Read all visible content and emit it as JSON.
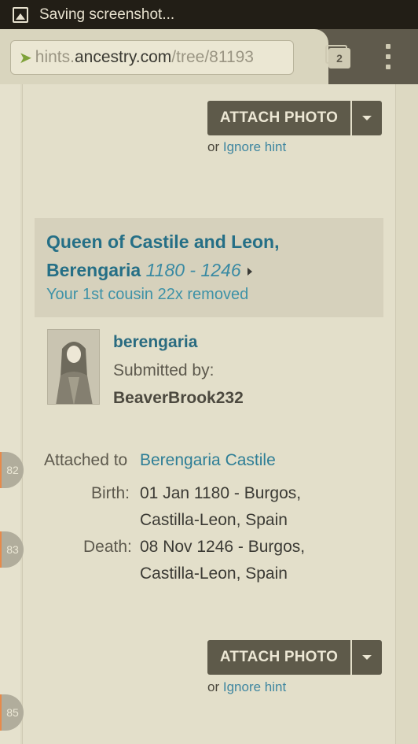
{
  "statusbar": {
    "text": "Saving screenshot..."
  },
  "browser": {
    "url_prefix": "hints.",
    "url_domain": "ancestry.com",
    "url_path": "/tree/81193",
    "tab_count": "2"
  },
  "actions": {
    "attach_label": "ATTACH PHOTO",
    "or_text": "or",
    "ignore_label": "Ignore hint"
  },
  "hint": {
    "name_line1": "Queen of Castile and Leon,",
    "name_line2": "Berengaria",
    "years": "1180 - 1246",
    "relationship": "Your 1st cousin 22x removed"
  },
  "record": {
    "title": "berengaria",
    "submitted_label": "Submitted by:",
    "submitter": "BeaverBrook232",
    "attached_label": "Attached to",
    "attached_to": "Berengaria Castile",
    "birth_label": "Birth:",
    "birth_line1": "01 Jan 1180 - Burgos,",
    "birth_line2": "Castilla-Leon, Spain",
    "death_label": "Death:",
    "death_line1": "08 Nov 1246 - Burgos,",
    "death_line2": "Castilla-Leon, Spain"
  },
  "badges": [
    "82",
    "83",
    "85"
  ],
  "colors": {
    "accent": "#e78a4a",
    "link": "#3e86a0",
    "button": "#5e5a4a"
  }
}
